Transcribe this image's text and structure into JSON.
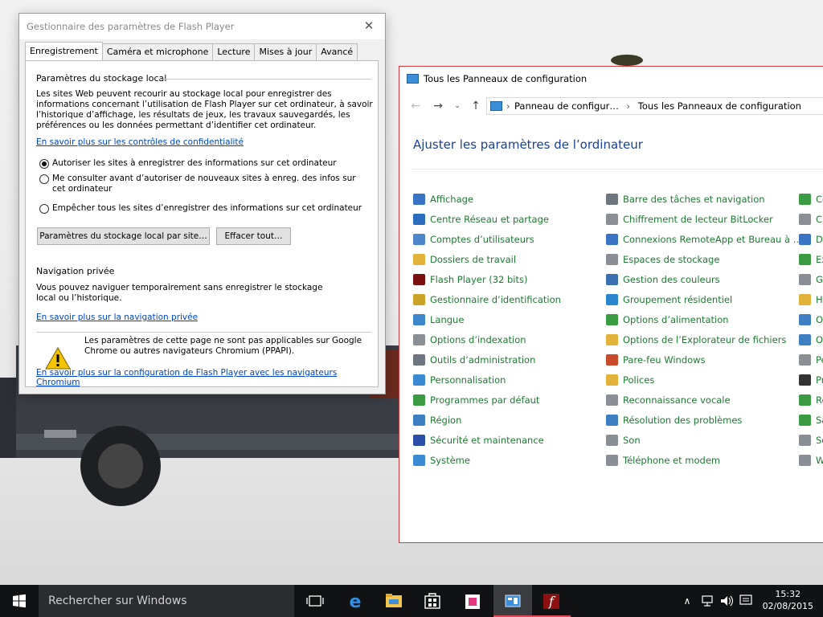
{
  "flash": {
    "title": "Gestionnaire des paramètres de Flash Player",
    "close": "✕",
    "tabs": [
      "Enregistrement",
      "Caméra et microphone",
      "Lecture",
      "Mises à jour",
      "Avancé"
    ],
    "storage_title": "Paramètres du stockage local",
    "storage_desc": "Les sites Web peuvent recourir au stockage local pour enregistrer des informations concernant l’utilisation de Flash Player sur cet ordinateur, à savoir l’historique d’affichage, les résultats de jeux, les travaux sauvegardés, les préférences ou les données permettant d’identifier cet ordinateur.",
    "privacy_link": "En savoir plus sur les contrôles de confidentialité",
    "radio_allow": "Autoriser les sites à enregistrer des informations sur cet ordinateur",
    "radio_ask": "Me consulter avant d’autoriser de nouveaux sites à enreg. des infos sur cet ordinateur",
    "radio_block": "Empêcher tous les sites d’enregistrer des informations sur cet ordinateur",
    "btn_site_settings": "Paramètres du stockage local par site…",
    "btn_clear_all": "Effacer tout…",
    "private_title": "Navigation privée",
    "private_desc": "Vous pouvez naviguer temporairement sans enregistrer le stockage local ou l’historique.",
    "private_link": "En savoir plus sur la navigation privée",
    "warning_text": "Les paramètres de cette page ne sont pas applicables sur Google Chrome ou autres navigateurs Chromium (PPAPI).",
    "chromium_link": "En savoir plus sur la configuration de Flash Player avec les navigateurs Chromium"
  },
  "controlpanel": {
    "title": "Tous les Panneaux de configuration",
    "crumb1": "Panneau de configur…",
    "crumb2": "Tous les Panneaux de configuration",
    "heading": "Ajuster les paramètres de l’ordinateur",
    "col1": [
      "Affichage",
      "Centre Réseau et partage",
      "Comptes d’utilisateurs",
      "Dossiers de travail",
      "Flash Player (32 bits)",
      "Gestionnaire d’identification",
      "Langue",
      "Options d’indexation",
      "Outils d’administration",
      "Personnalisation",
      "Programmes par défaut",
      "Région",
      "Sécurité et maintenance",
      "Système"
    ],
    "col2": [
      "Barre des tâches et navigation",
      "Chiffrement de lecteur BitLocker",
      "Connexions RemoteApp et Bureau à …",
      "Espaces de stockage",
      "Gestion des couleurs",
      "Groupement résidentiel",
      "Options d’alimentation",
      "Options de l’Explorateur de fichiers",
      "Pare-feu Windows",
      "Polices",
      "Reconnaissance vocale",
      "Résolution des problèmes",
      "Son",
      "Téléphone et modem"
    ],
    "col3": [
      "Ce",
      "Cl",
      "Da",
      "Ex",
      "Ge",
      "H",
      "O",
      "O",
      "Pe",
      "Pr",
      "Re",
      "Sa",
      "Sc",
      "W"
    ]
  },
  "taskbar": {
    "search_placeholder": "Rechercher sur Windows",
    "time": "15:32",
    "date": "02/08/2015"
  }
}
